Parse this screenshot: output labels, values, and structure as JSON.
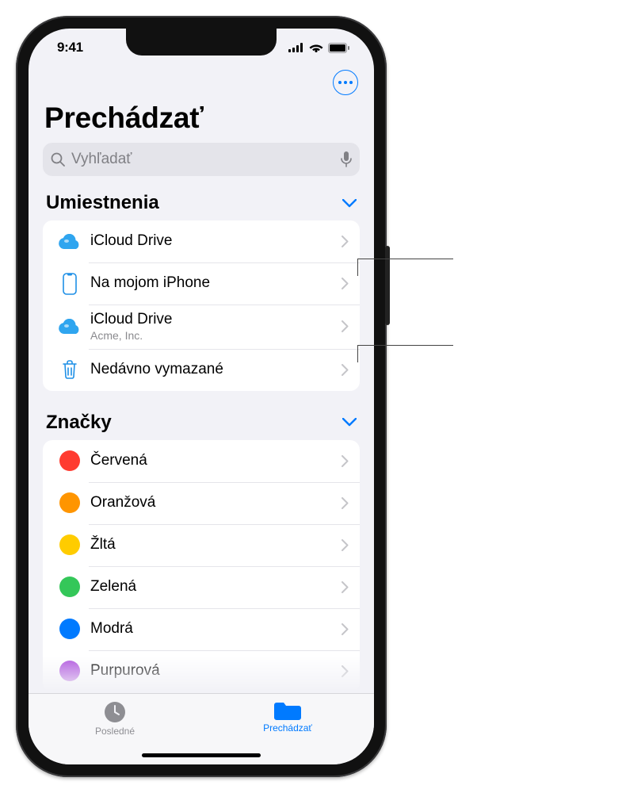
{
  "status": {
    "time": "9:41"
  },
  "header": {
    "title": "Prechádzať"
  },
  "search": {
    "placeholder": "Vyhľadať"
  },
  "sections": {
    "locations": {
      "title": "Umiestnenia",
      "items": [
        {
          "label": "iCloud Drive",
          "sub": "",
          "icon": "cloud"
        },
        {
          "label": "Na mojom iPhone",
          "sub": "",
          "icon": "phone"
        },
        {
          "label": "iCloud Drive",
          "sub": "Acme, Inc.",
          "icon": "cloud"
        },
        {
          "label": "Nedávno vymazané",
          "sub": "",
          "icon": "trash"
        }
      ]
    },
    "tags": {
      "title": "Značky",
      "items": [
        {
          "label": "Červená",
          "color": "#ff3b30"
        },
        {
          "label": "Oranžová",
          "color": "#ff9500"
        },
        {
          "label": "Žltá",
          "color": "#ffcc00"
        },
        {
          "label": "Zelená",
          "color": "#34c759"
        },
        {
          "label": "Modrá",
          "color": "#007aff"
        },
        {
          "label": "Purpurová",
          "color": "#af52de"
        }
      ]
    }
  },
  "tabs": {
    "recent": "Posledné",
    "browse": "Prechádzať"
  }
}
